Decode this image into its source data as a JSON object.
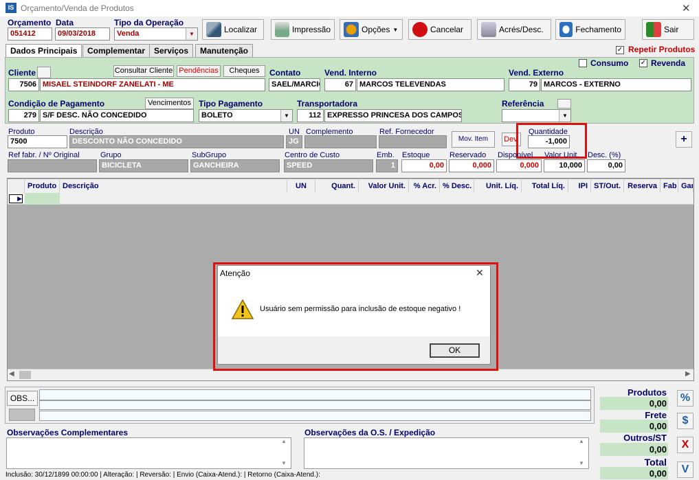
{
  "window": {
    "title": "Orçamento/Venda de Produtos",
    "app_badge": "IS"
  },
  "header": {
    "orcamento_label": "Orçamento",
    "orcamento": "051412",
    "data_label": "Data",
    "data": "09/03/2018",
    "tipo_operacao_label": "Tipo da Operação",
    "tipo_operacao": "Venda"
  },
  "toolbar": {
    "localizar": "Localizar",
    "impressao": "Impressão",
    "opcoes": "Opções",
    "cancelar": "Cancelar",
    "acres_desc": "Acrés/Desc.",
    "fechamento": "Fechamento",
    "sair": "Sair"
  },
  "tabs": [
    "Dados Principais",
    "Complementar",
    "Serviços",
    "Manutenção"
  ],
  "repetir_produtos": "Repetir Produtos",
  "consumo": "Consumo",
  "revenda": "Revenda",
  "cliente": {
    "label": "Cliente",
    "codigo": "7506",
    "nome": "MISAEL STEINDORF ZANELATI - ME",
    "consultar": "Consultar Cliente",
    "pendencias": "Pendências",
    "cheques": "Cheques"
  },
  "contato": {
    "label": "Contato",
    "valor": "SAEL/MARCIO"
  },
  "vend_interno": {
    "label": "Vend. Interno",
    "codigo": "67",
    "nome": "MARCOS TELEVENDAS"
  },
  "vend_externo": {
    "label": "Vend. Externo",
    "codigo": "79",
    "nome": "MARCOS - EXTERNO"
  },
  "condicao": {
    "label": "Condição de Pagamento",
    "vencimentos": "Vencimentos",
    "codigo": "279",
    "nome": "S/F DESC. NÃO CONCEDIDO"
  },
  "tipo_pagamento": {
    "label": "Tipo Pagamento",
    "valor": "BOLETO"
  },
  "transportadora": {
    "label": "Transportadora",
    "codigo": "112",
    "nome": "EXPRESSO PRINCESA DOS CAMPOS S"
  },
  "referencia": {
    "label": "Referência"
  },
  "item": {
    "produto_label": "Produto",
    "produto": "7500",
    "descricao_label": "Descrição",
    "descricao": "DESCONTO NÃO CONCEDIDO",
    "un_label": "UN",
    "un": "JG",
    "complemento_label": "Complemento",
    "ref_fornecedor_label": "Ref. Fornecedor",
    "mov_item": "Mov. Item",
    "dev": "Dev.",
    "quantidade_label": "Quantidade",
    "quantidade": "-1,000",
    "add": "+",
    "ref_fabr_label": "Ref fabr. / Nº Original",
    "grupo_label": "Grupo",
    "grupo": "BICICLETA",
    "subgrupo_label": "SubGrupo",
    "subgrupo": "GANCHEIRA",
    "centro_custo_label": "Centro de Custo",
    "centro_custo": "SPEED",
    "emb_label": "Emb.",
    "emb": "1",
    "estoque_label": "Estoque",
    "estoque": "0,00",
    "reservado_label": "Reservado",
    "reservado": "0,000",
    "disponivel_label": "Disponível",
    "disponivel": "0,000",
    "valor_unit_label": "Valor Unit.",
    "valor_unit": "10,000",
    "desc_pct_label": "Desc. (%)",
    "desc_pct": "0,00"
  },
  "grid": {
    "columns": [
      "Produto",
      "Descrição",
      "UN",
      "Quant.",
      "Valor Unit.",
      "% Acr.",
      "% Desc.",
      "Unit. Líq.",
      "Total Líq.",
      "IPI",
      "ST/Out.",
      "Reserva",
      "Fab",
      "Gar"
    ]
  },
  "dialog": {
    "title": "Atenção",
    "message": "Usuário sem permissão para inclusão de estoque negativo !",
    "ok": "OK"
  },
  "obs": {
    "button": "OBS...",
    "complementares_label": "Observações Complementares",
    "os_label": "Observações da O.S. / Expedição"
  },
  "totals": {
    "produtos_label": "Produtos",
    "produtos": "0,00",
    "frete_label": "Frete",
    "frete": "0,00",
    "outros_label": "Outros/ST",
    "outros": "0,00",
    "total_label": "Total",
    "total": "0,00"
  },
  "side": {
    "pct": "%",
    "dollar": "$",
    "x": "X",
    "v": "V"
  },
  "status": "Inclusão:  30/12/1899 00:00:00 | Alteração:  | Reversão:  | Envio (Caixa-Atend.):  | Retorno (Caixa-Atend.):"
}
